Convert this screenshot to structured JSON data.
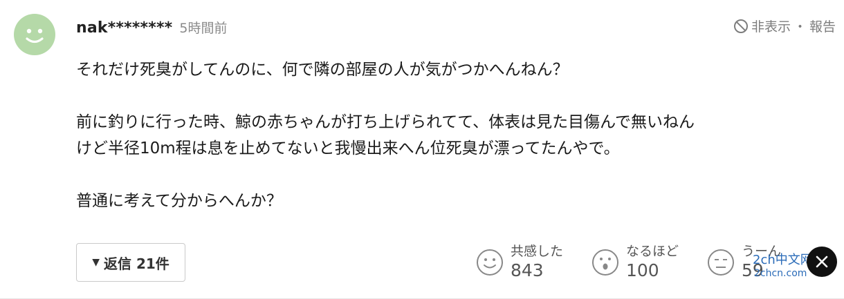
{
  "header": {
    "username": "nak********",
    "time": "5時間前",
    "hide_label": "非表示",
    "separator": "・",
    "report_label": "報告"
  },
  "comment": {
    "lines": [
      "それだけ死臭がしてんのに、何で隣の部屋の人が気がつかへんねん？",
      "前に釣りに行った時、鯨の赤ちゃんが打ち上げられてて、体表は見た目傷んで無いねん",
      "けど半径10m程は息を止めてないと我慢出来へん位死臭が漂ってたんやで。",
      "普通に考えて分からへんか？"
    ]
  },
  "reply_button": {
    "label": "返信 21件"
  },
  "reactions": [
    {
      "icon": "smile-icon",
      "label": "共感した",
      "count": "843"
    },
    {
      "icon": "surprised-icon",
      "label": "なるほど",
      "count": "100"
    },
    {
      "icon": "hmm-icon",
      "label": "うーん",
      "count": "59"
    }
  ],
  "watermark": {
    "text": "2ch中文网",
    "url": "2chcn.com"
  },
  "colors": {
    "avatar_bg": "#b5d9a8",
    "muted_text": "#8a8a8a",
    "x_button_bg": "#111111",
    "watermark": "#2a6bb8"
  }
}
